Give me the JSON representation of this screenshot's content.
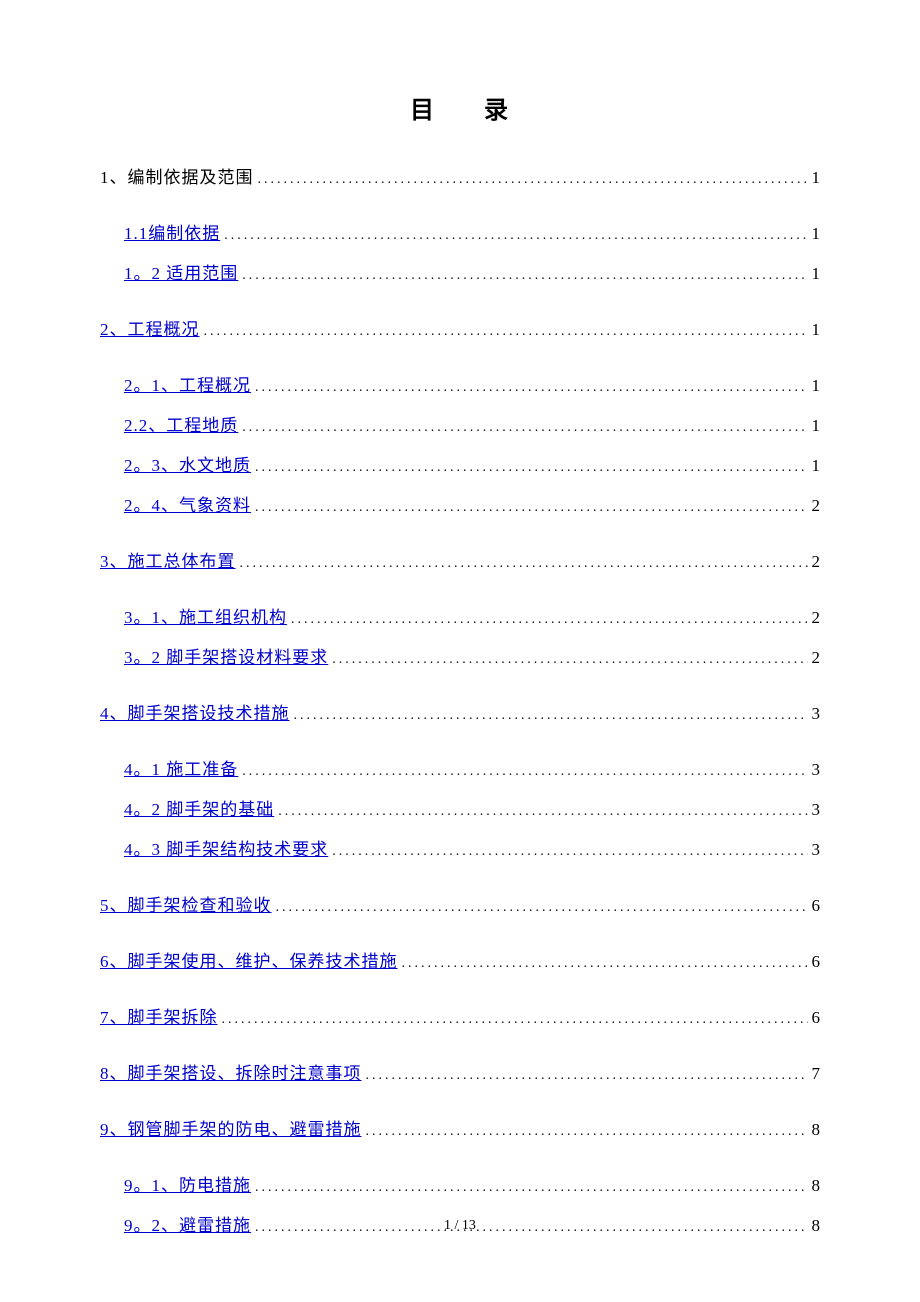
{
  "title": {
    "left": "目",
    "right": "录"
  },
  "pager": "1 / 13",
  "toc": [
    {
      "label": "1、编制依据及范围",
      "page": "1",
      "indent": false,
      "link": false,
      "group": true
    },
    {
      "label": "1.1编制依据",
      "page": "1",
      "indent": true,
      "link": true,
      "sub_first": true
    },
    {
      "label": "1。2 适用范围",
      "page": "1",
      "indent": true,
      "link": true
    },
    {
      "label": "2、工程概况",
      "page": "1",
      "indent": false,
      "link": true,
      "group": true
    },
    {
      "label": "2。1、工程概况",
      "page": "1",
      "indent": true,
      "link": true,
      "sub_first": true
    },
    {
      "label": "2.2、工程地质",
      "page": "1",
      "indent": true,
      "link": true
    },
    {
      "label": "2。3、水文地质",
      "page": "1",
      "indent": true,
      "link": true
    },
    {
      "label": "2。4、气象资料",
      "page": "2",
      "indent": true,
      "link": true
    },
    {
      "label": "3、施工总体布置",
      "page": "2",
      "indent": false,
      "link": true,
      "group": true
    },
    {
      "label": "3。1、施工组织机构",
      "page": "2",
      "indent": true,
      "link": true,
      "sub_first": true
    },
    {
      "label": "3。2 脚手架搭设材料要求",
      "page": "2",
      "indent": true,
      "link": true
    },
    {
      "label": "4、脚手架搭设技术措施",
      "page": "3",
      "indent": false,
      "link": true,
      "group": true
    },
    {
      "label": "4。1 施工准备",
      "page": "3",
      "indent": true,
      "link": true,
      "sub_first": true
    },
    {
      "label": "4。2 脚手架的基础",
      "page": "3",
      "indent": true,
      "link": true
    },
    {
      "label": "4。3 脚手架结构技术要求",
      "page": "3",
      "indent": true,
      "link": true
    },
    {
      "label": "5、脚手架检查和验收",
      "page": "6",
      "indent": false,
      "link": true,
      "group": true
    },
    {
      "label": "6、脚手架使用、维护、保养技术措施",
      "page": "6",
      "indent": false,
      "link": true,
      "group": true
    },
    {
      "label": "7、脚手架拆除",
      "page": "6",
      "indent": false,
      "link": true,
      "group": true
    },
    {
      "label": "8、脚手架搭设、拆除时注意事项",
      "page": "7",
      "indent": false,
      "link": true,
      "group": true
    },
    {
      "label": "9、钢管脚手架的防电、避雷措施",
      "page": "8",
      "indent": false,
      "link": true,
      "group": true
    },
    {
      "label": "9。1、防电措施",
      "page": "8",
      "indent": true,
      "link": true,
      "sub_first": true
    },
    {
      "label": "9。2、避雷措施",
      "page": "8",
      "indent": true,
      "link": true
    }
  ]
}
